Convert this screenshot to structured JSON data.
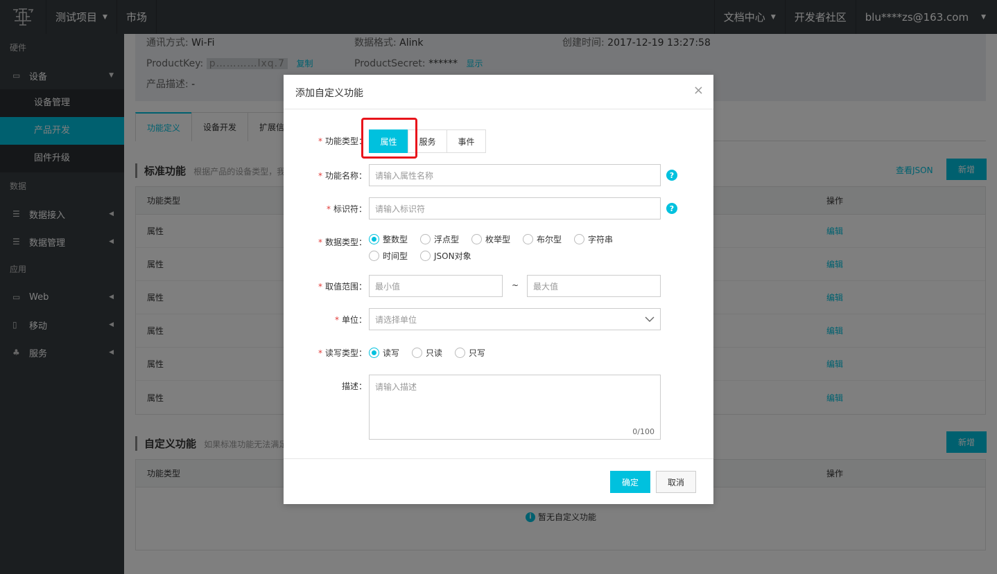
{
  "topbar": {
    "project": "测试项目",
    "market": "市场",
    "docs": "文档中心",
    "community": "开发者社区",
    "user": "blu****zs@163.com"
  },
  "sidebar": {
    "sections": {
      "hardware": "硬件",
      "data": "数据",
      "app": "应用"
    },
    "device": "设备",
    "sub_items": [
      "设备管理",
      "产品开发",
      "固件升级"
    ],
    "data_access": "数据接入",
    "data_manage": "数据管理",
    "web": "Web",
    "mobile": "移动",
    "service": "服务"
  },
  "info": {
    "comm_label": "通讯方式:",
    "comm_value": "Wi-Fi",
    "format_label": "数据格式:",
    "format_value": "Alink",
    "created_label": "创建时间:",
    "created_value": "2017-12-19 13:27:58",
    "pk_label": "ProductKey:",
    "pk_value": "p…………lxq.7",
    "copy": "复制",
    "ps_label": "ProductSecret:",
    "ps_value": "******",
    "show": "显示",
    "desc_label": "产品描述:",
    "desc_value": "-"
  },
  "tabs": [
    "功能定义",
    "设备开发",
    "扩展信"
  ],
  "standard": {
    "title": "标准功能",
    "sub": "根据产品的设备类型，我们",
    "view_json": "查看JSON",
    "add": "新增",
    "col_type": "功能类型",
    "col_op": "操作",
    "rows": [
      {
        "type": "属性",
        "op": "编辑"
      },
      {
        "type": "属性",
        "op": "编辑"
      },
      {
        "type": "属性",
        "op": "编辑"
      },
      {
        "type": "属性",
        "op": "编辑"
      },
      {
        "type": "属性",
        "op": "编辑"
      },
      {
        "type": "属性",
        "op": "编辑"
      }
    ]
  },
  "custom": {
    "title": "自定义功能",
    "sub": "如果标准功能无法满足",
    "add": "新增",
    "col_type": "功能类型",
    "col_op": "操作",
    "empty": "暂无自定义功能"
  },
  "dialog": {
    "title": "添加自定义功能",
    "close": "×",
    "type_label": "功能类型：",
    "type_options": [
      "属性",
      "服务",
      "事件"
    ],
    "name_label": "功能名称：",
    "name_placeholder": "请输入属性名称",
    "id_label": "标识符：",
    "id_placeholder": "请输入标识符",
    "dtype_label": "数据类型：",
    "dtypes": [
      "整数型",
      "浮点型",
      "枚举型",
      "布尔型",
      "字符串",
      "时间型",
      "JSON对象"
    ],
    "range_label": "取值范围：",
    "min_placeholder": "最小值",
    "tilde": "~",
    "max_placeholder": "最大值",
    "unit_label": "单位：",
    "unit_placeholder": "请选择单位",
    "rw_label": "读写类型：",
    "rw_options": [
      "读写",
      "只读",
      "只写"
    ],
    "desc_label": "描述：",
    "desc_placeholder": "请输入描述",
    "counter": "0/100",
    "ok": "确定",
    "cancel": "取消"
  },
  "colors": {
    "accent": "#00c1de",
    "topbar": "#373d41",
    "highlight": "#e8141b"
  }
}
